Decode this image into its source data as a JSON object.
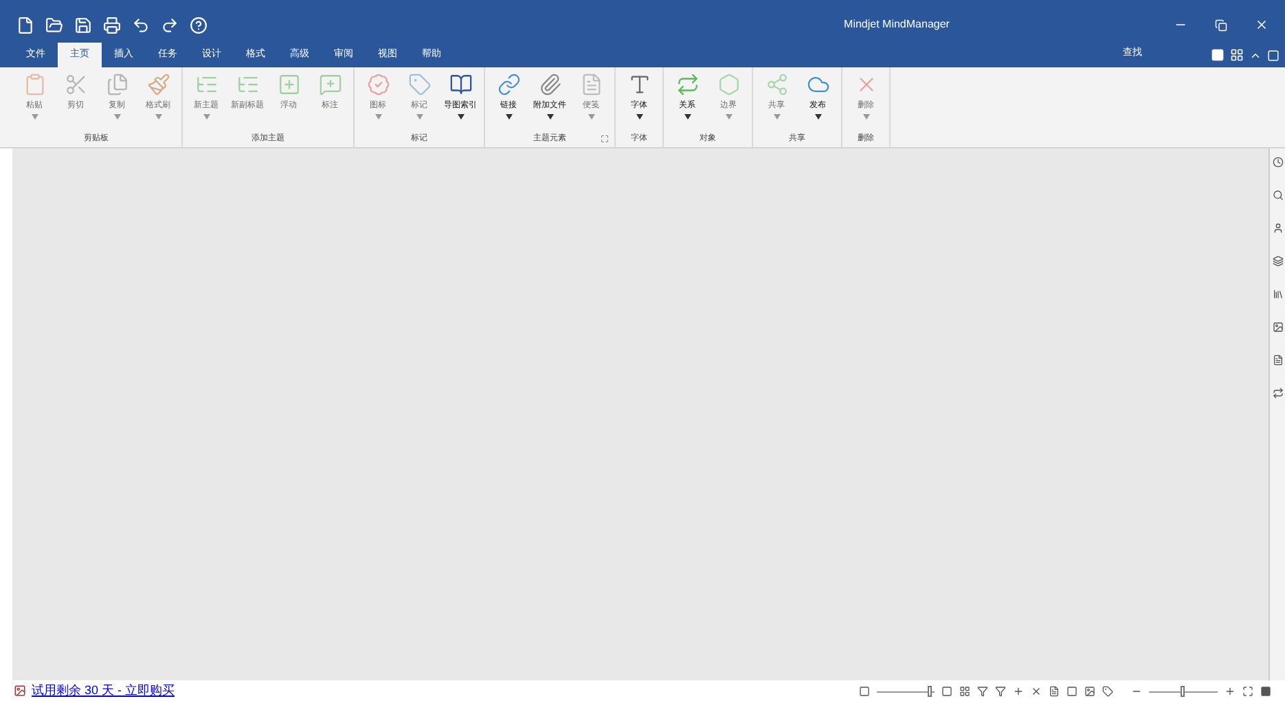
{
  "window": {
    "title": "Mindjet MindManager"
  },
  "tabs": [
    {
      "label": "文件",
      "selected": false
    },
    {
      "label": "主页",
      "selected": true
    },
    {
      "label": "插入",
      "selected": false
    },
    {
      "label": "任务",
      "selected": false
    },
    {
      "label": "设计",
      "selected": false
    },
    {
      "label": "格式",
      "selected": false
    },
    {
      "label": "高级",
      "selected": false
    },
    {
      "label": "审阅",
      "selected": false
    },
    {
      "label": "视图",
      "selected": false
    },
    {
      "label": "帮助",
      "selected": false
    }
  ],
  "search": {
    "label": "查找"
  },
  "ribbon": [
    {
      "label": "剪贴板",
      "buttons": [
        {
          "label": "粘贴",
          "disabled": true,
          "dropdown": true
        },
        {
          "label": "剪切",
          "disabled": true,
          "dropdown": false
        },
        {
          "label": "复制",
          "disabled": true,
          "dropdown": true
        },
        {
          "label": "格式刷",
          "disabled": true,
          "dropdown": true
        }
      ]
    },
    {
      "label": "添加主题",
      "buttons": [
        {
          "label": "新主题",
          "disabled": true,
          "dropdown": true
        },
        {
          "label": "新副标题",
          "disabled": true,
          "dropdown": false
        },
        {
          "label": "浮动",
          "disabled": true,
          "dropdown": false
        },
        {
          "label": "标注",
          "disabled": true,
          "dropdown": false
        }
      ]
    },
    {
      "label": "标记",
      "buttons": [
        {
          "label": "图标",
          "disabled": true,
          "dropdown": true
        },
        {
          "label": "标记",
          "disabled": true,
          "dropdown": true
        },
        {
          "label": "导图索引",
          "disabled": false,
          "dropdown": true
        }
      ]
    },
    {
      "label": "主题元素",
      "launcher": true,
      "buttons": [
        {
          "label": "链接",
          "disabled": false,
          "dropdown": true
        },
        {
          "label": "附加文件",
          "disabled": false,
          "dropdown": true
        },
        {
          "label": "便笺",
          "disabled": true,
          "dropdown": true
        }
      ]
    },
    {
      "label": "字体",
      "buttons": [
        {
          "label": "字体",
          "disabled": false,
          "dropdown": true
        }
      ]
    },
    {
      "label": "对象",
      "buttons": [
        {
          "label": "关系",
          "disabled": false,
          "dropdown": true
        },
        {
          "label": "边界",
          "disabled": true,
          "dropdown": true
        }
      ]
    },
    {
      "label": "共享",
      "buttons": [
        {
          "label": "共享",
          "disabled": true,
          "dropdown": true
        },
        {
          "label": "发布",
          "disabled": false,
          "dropdown": true
        }
      ]
    },
    {
      "label": "删除",
      "buttons": [
        {
          "label": "删除",
          "disabled": true,
          "dropdown": true
        }
      ]
    }
  ],
  "status_bar": {
    "trial_link": "试用剩余 30 天 - 立即购买",
    "detail_slider": {
      "level": 0.92
    },
    "zoom_slider": {
      "level": 0.5
    }
  }
}
